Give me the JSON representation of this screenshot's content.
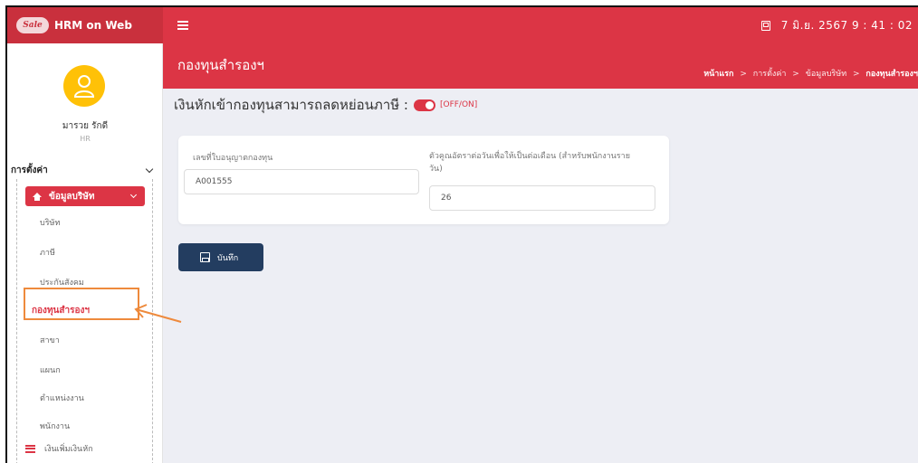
{
  "header": {
    "app_title": "HRM on Web",
    "logo_text": "Sale",
    "datetime": "7 มิ.ย. 2567  9 : 41 : 02",
    "accent_color": "#dc3545"
  },
  "sidebar": {
    "user_name": "มารวย รักดี",
    "user_role": "HR",
    "section_label": "การตั้งค่า",
    "group_label": "ข้อมูลบริษัท",
    "items": [
      {
        "label": "บริษัท"
      },
      {
        "label": "ภาษี"
      },
      {
        "label": "ประกันสังคม"
      },
      {
        "label": "กองทุนสำรองฯ"
      },
      {
        "label": "สาขา"
      },
      {
        "label": "แผนก"
      },
      {
        "label": "ตำแหน่งงาน"
      },
      {
        "label": "พนักงาน"
      }
    ],
    "bottom_item": "เงินเพิ่มเงินหัก"
  },
  "page": {
    "title": "กองทุนสำรองฯ",
    "breadcrumb": [
      "หน้าแรก",
      "การตั้งค่า",
      "ข้อมูลบริษัท",
      "กองทุนสำรองฯ"
    ],
    "breadcrumb_sep": ">"
  },
  "form": {
    "toggle_label": "เงินหักเข้ากองทุนสามารถลดหย่อนภาษี :",
    "toggle_state": "[OFF/ON]",
    "toggle_on": true,
    "license_label": "เลขที่ใบอนุญาตกองทุน",
    "license_value": "A001555",
    "multiplier_label_line1": "ตัวคูณอัตราต่อวันเพื่อให้เป็นต่อเดือน (สำหรับพนักงานราย",
    "multiplier_label_line2": "วัน)",
    "multiplier_value": "26",
    "save_label": "บันทึก"
  }
}
